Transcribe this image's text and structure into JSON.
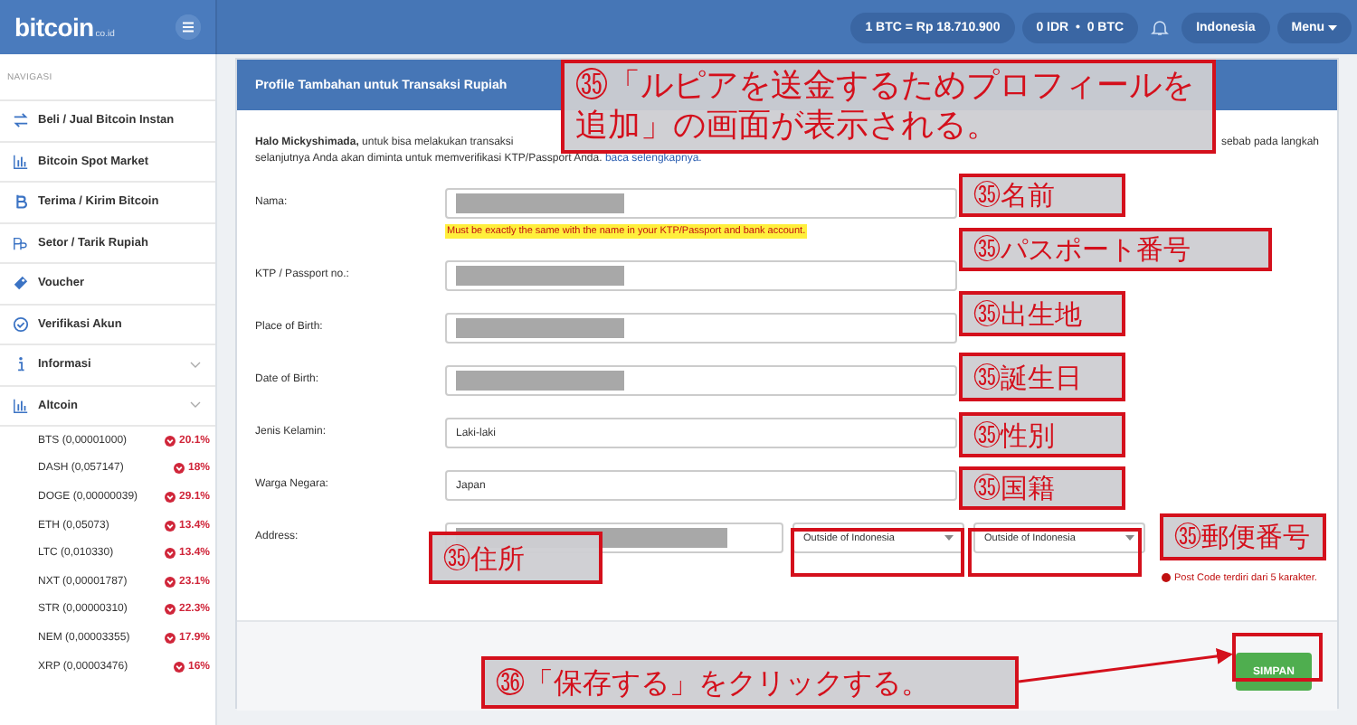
{
  "header": {
    "logo": "bitcoin",
    "logo_suffix": "co.id",
    "price": "1 BTC = Rp 18.710.900",
    "balance": "0 IDR  •  0 BTC",
    "language": "Indonesia",
    "menu": "Menu"
  },
  "sidebar": {
    "heading": "NAVIGASI",
    "items": [
      {
        "label": "Beli / Jual Bitcoin Instan",
        "expandable": false
      },
      {
        "label": "Bitcoin Spot Market",
        "expandable": false
      },
      {
        "label": "Terima / Kirim Bitcoin",
        "expandable": false
      },
      {
        "label": "Setor / Tarik Rupiah",
        "expandable": false
      },
      {
        "label": "Voucher",
        "expandable": false
      },
      {
        "label": "Verifikasi Akun",
        "expandable": false
      },
      {
        "label": "Informasi",
        "expandable": true
      },
      {
        "label": "Altcoin",
        "expandable": true
      }
    ],
    "altcoins": [
      {
        "name": "BTS (0,00001000)",
        "change": "20.1%"
      },
      {
        "name": "DASH (0,057147)",
        "change": "18%"
      },
      {
        "name": "DOGE (0,00000039)",
        "change": "29.1%"
      },
      {
        "name": "ETH (0,05073)",
        "change": "13.4%"
      },
      {
        "name": "LTC (0,010330)",
        "change": "13.4%"
      },
      {
        "name": "NXT (0,00001787)",
        "change": "23.1%"
      },
      {
        "name": "STR (0,00000310)",
        "change": "22.3%"
      },
      {
        "name": "NEM (0,00003355)",
        "change": "17.9%"
      },
      {
        "name": "XRP (0,00003476)",
        "change": "16%"
      }
    ]
  },
  "form": {
    "title": "Profile Tambahan untuk Transaksi Rupiah",
    "intro_start": "**Halo Mickyshimada,** untuk bisa melakukan transaksi",
    "intro_end": "sebab pada langkah",
    "intro": "selanjutnya Anda akan diminta untuk memverifikasi KTP/Passport Anda.",
    "intro_link": "baca selengkapnya.",
    "fields": [
      {
        "kind": "text",
        "label": "Nama:",
        "redacted": true,
        "hint": "Must be exactly the same with the name in your KTP/Passport and bank account."
      },
      {
        "kind": "text",
        "label": "KTP / Passport no.:",
        "redacted": true
      },
      {
        "kind": "text",
        "label": "Place of Birth:",
        "redacted": true
      },
      {
        "kind": "text",
        "label": "Date of Birth:",
        "redacted": true
      },
      {
        "kind": "text",
        "label": "Jenis Kelamin:",
        "redacted": false,
        "value": "Laki-laki"
      },
      {
        "kind": "text",
        "label": "Warga Negara:",
        "redacted": false,
        "value": "Japan"
      },
      {
        "kind": "address",
        "label": "Address:",
        "redacted": true,
        "selects": [
          "Outside of Indonesia",
          "Outside of Indonesia"
        ],
        "error": "Post Code terdiri dari 5 karakter."
      }
    ],
    "submit": "SIMPAN"
  },
  "annotations": [
    {
      "text": "㉟「ルピアを送金するためプロフィールを追加」の画面が表示される。"
    },
    {
      "text": "㉟名前"
    },
    {
      "text": "㉟パスポート番号"
    },
    {
      "text": "㉟出生地"
    },
    {
      "text": "㉟誕生日"
    },
    {
      "text": "㉟性別"
    },
    {
      "text": "㉟国籍"
    },
    {
      "text": "㉟郵便番号"
    },
    {
      "text": "㉟住所"
    },
    {
      "text": "㊱「保存する」をクリックする。"
    }
  ]
}
